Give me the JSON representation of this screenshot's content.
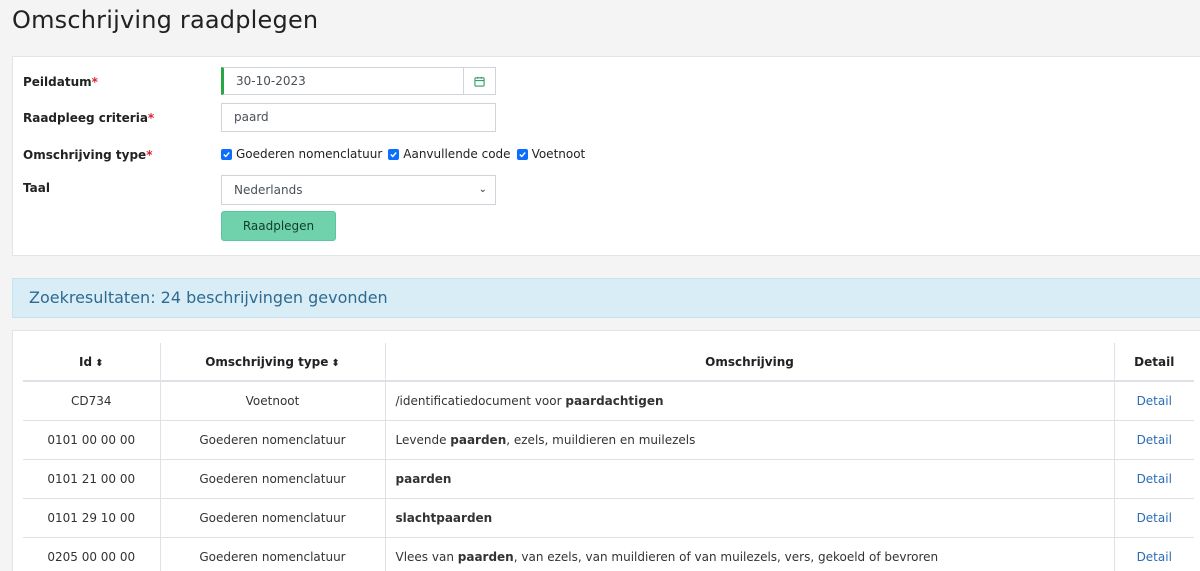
{
  "page": {
    "title": "Omschrijving raadplegen"
  },
  "form": {
    "peildatum": {
      "label": "Peildatum",
      "value": "30-10-2023"
    },
    "criteria": {
      "label": "Raadpleeg criteria",
      "value": "paard"
    },
    "type": {
      "label": "Omschrijving type",
      "options": [
        {
          "label": "Goederen nomenclatuur",
          "checked": true
        },
        {
          "label": "Aanvullende code",
          "checked": true
        },
        {
          "label": "Voetnoot",
          "checked": true
        }
      ]
    },
    "taal": {
      "label": "Taal",
      "value": "Nederlands"
    },
    "required_mark": "*",
    "submit_label": "Raadplegen"
  },
  "results": {
    "summary": "Zoekresultaten: 24 beschrijvingen gevonden",
    "columns": {
      "id": "Id",
      "type": "Omschrijving type",
      "desc": "Omschrijving",
      "detail": "Detail"
    },
    "rows": [
      {
        "id": "CD734",
        "type": "Voetnoot",
        "desc_pre": "/identificatiedocument voor ",
        "desc_bold": "paardachtigen",
        "desc_post": "",
        "detail": "Detail"
      },
      {
        "id": "0101 00 00 00",
        "type": "Goederen nomenclatuur",
        "desc_pre": "Levende ",
        "desc_bold": "paarden",
        "desc_post": ", ezels, muildieren en muilezels",
        "detail": "Detail"
      },
      {
        "id": "0101 21 00 00",
        "type": "Goederen nomenclatuur",
        "desc_pre": "",
        "desc_bold": "paarden",
        "desc_post": "",
        "detail": "Detail"
      },
      {
        "id": "0101 29 10 00",
        "type": "Goederen nomenclatuur",
        "desc_pre": "",
        "desc_bold": "slachtpaarden",
        "desc_post": "",
        "detail": "Detail"
      },
      {
        "id": "0205 00 00 00",
        "type": "Goederen nomenclatuur",
        "desc_pre": "Vlees van ",
        "desc_bold": "paarden",
        "desc_post": ", van ezels, van muildieren of van muilezels, vers, gekoeld of bevroren",
        "detail": "Detail"
      }
    ]
  },
  "colors": {
    "accent_green": "#28a745",
    "button": "#6fd2ad",
    "info_bg": "#d9edf7",
    "link": "#2a6db3",
    "checkbox": "#0d6efd"
  },
  "icons": {
    "calendar": "calendar-icon",
    "chevron": "chevron-down-icon",
    "sort": "sort-icon",
    "check": "check-icon"
  }
}
